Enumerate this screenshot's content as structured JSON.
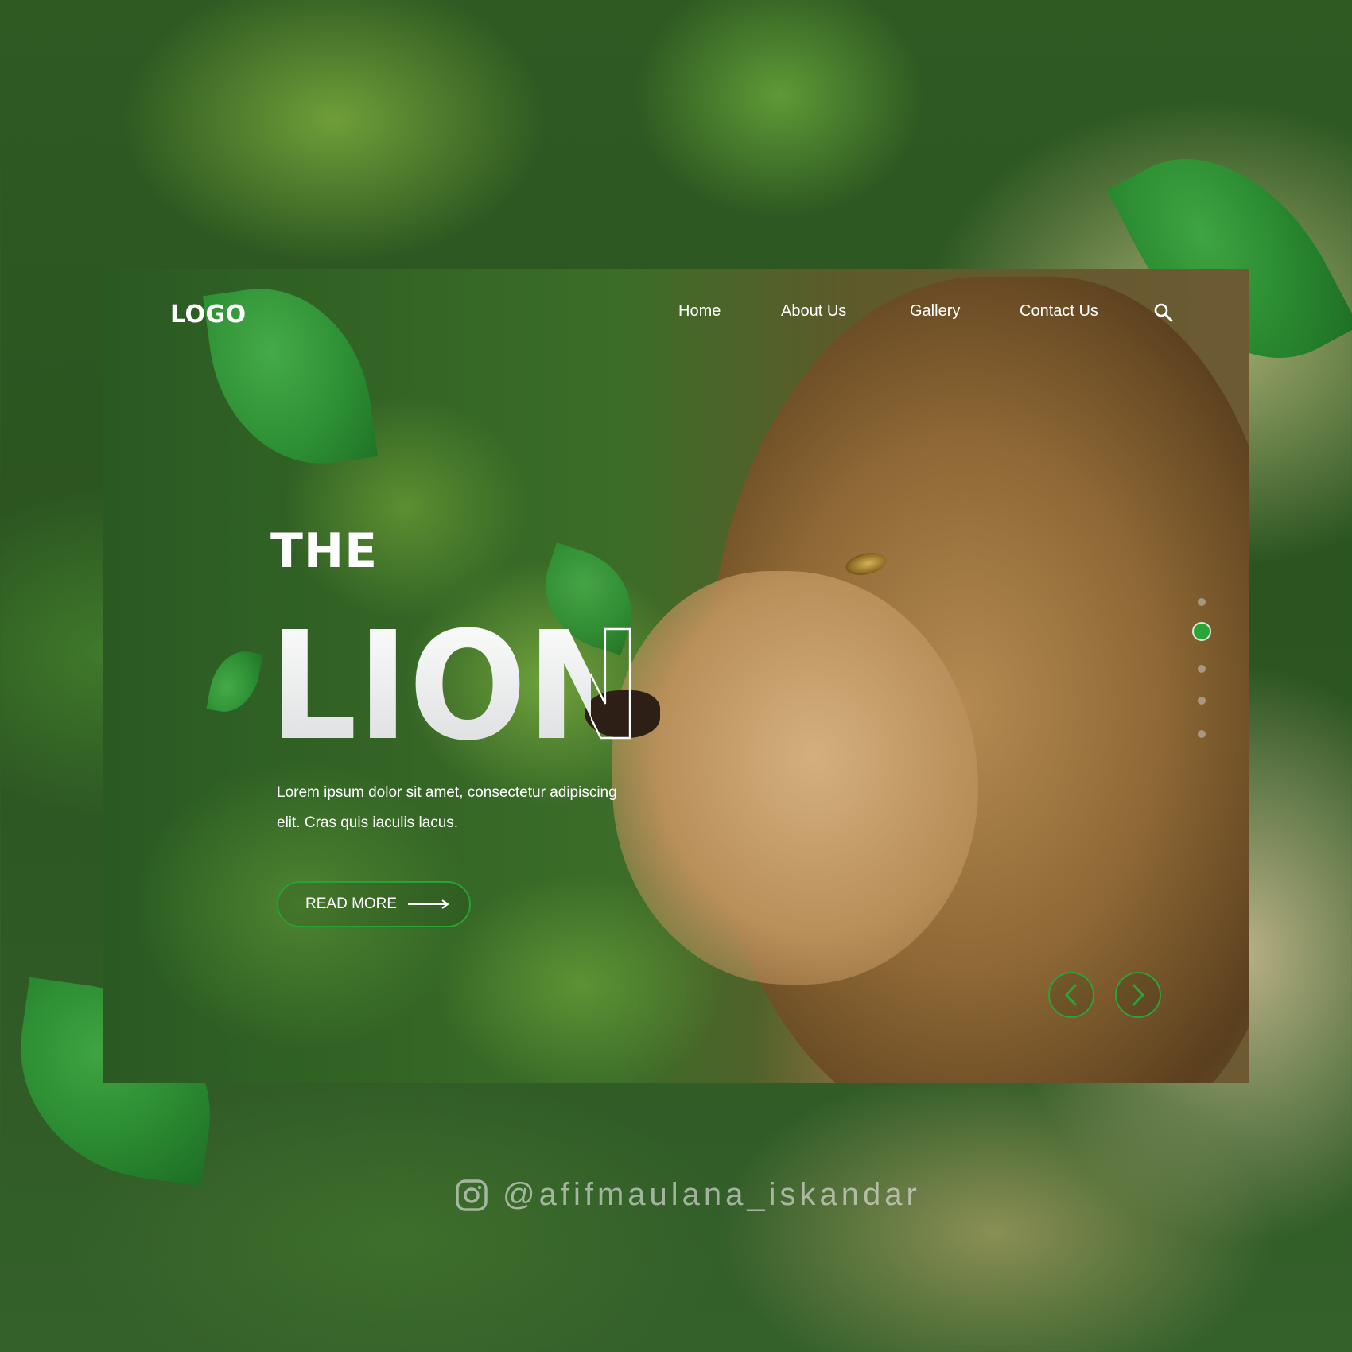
{
  "nav": {
    "logo": "LOGO",
    "links": [
      "Home",
      "About Us",
      "Gallery",
      "Contact Us"
    ],
    "search_icon": "search-icon"
  },
  "hero": {
    "kicker": "THE",
    "title": "LION",
    "description_line1": "Lorem ipsum dolor sit amet, consectetur adipiscing",
    "description_line2": "elit. Cras quis iaculis lacus.",
    "cta_label": "READ MORE"
  },
  "slider": {
    "dot_count": 5,
    "active_index": 1,
    "prev_icon": "chevron-left-icon",
    "next_icon": "chevron-right-icon"
  },
  "footer": {
    "icon": "instagram-icon",
    "handle": "@afifmaulana_iskandar"
  },
  "colors": {
    "accent": "#2aa43a",
    "text": "#ffffff"
  }
}
